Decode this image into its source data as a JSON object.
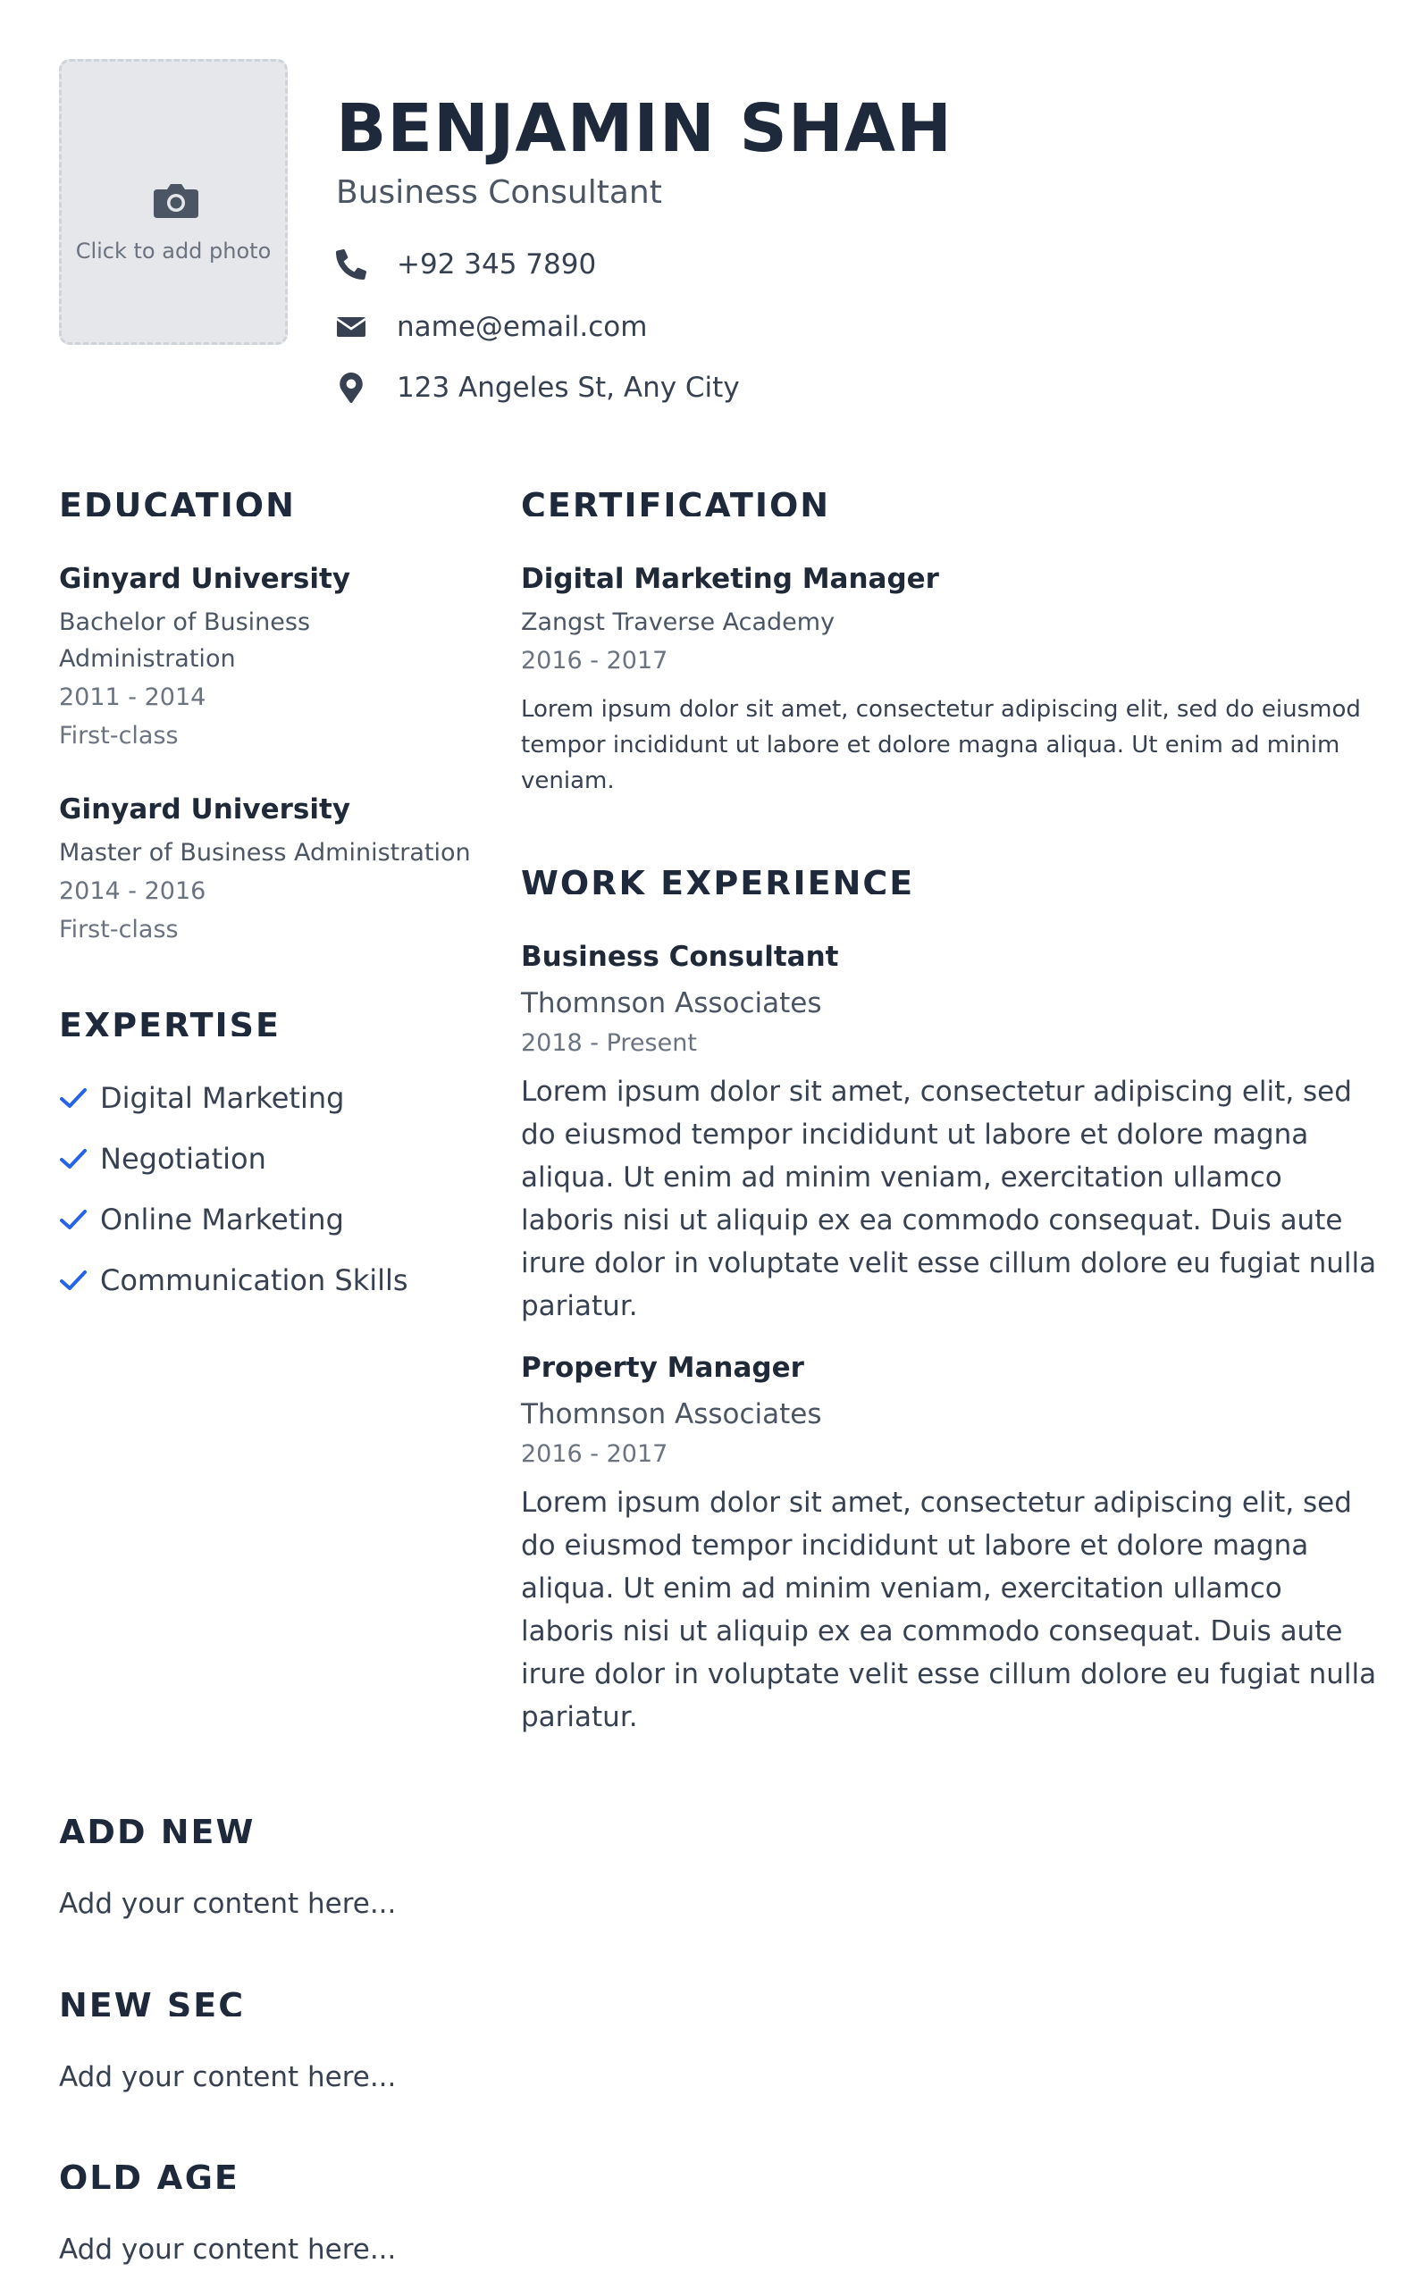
{
  "header": {
    "photo_label": "Click to add photo",
    "name": "BENJAMIN SHAH",
    "title": "Business Consultant",
    "phone": "+92 345 7890",
    "email": "name@email.com",
    "address": "123 Angeles St, Any City"
  },
  "education": {
    "title": "EDUCATION",
    "items": [
      {
        "school": "Ginyard University",
        "degree_line1": "Bachelor of Business",
        "degree_line2": "Administration",
        "years": "2011 - 2014",
        "grade": "First-class"
      },
      {
        "school": "Ginyard University",
        "degree": "Master of Business Administration",
        "years": "2014 - 2016",
        "grade": "First-class"
      }
    ]
  },
  "expertise": {
    "title": "EXPERTISE",
    "items": [
      "Digital Marketing",
      "Negotiation",
      "Online Marketing",
      "Communication Skills"
    ]
  },
  "certification": {
    "title": "CERTIFICATION",
    "name": "Digital Marketing Manager",
    "issuer": "Zangst Traverse Academy",
    "years": "2016 - 2017",
    "description": "Lorem ipsum dolor sit amet, consectetur adipiscing elit, sed do eiusmod tempor incididunt ut labore et dolore magna aliqua. Ut enim ad minim veniam."
  },
  "work": {
    "title": "WORK EXPERIENCE",
    "items": [
      {
        "role": "Business Consultant",
        "company": "Thomnson Associates",
        "years": "2018 - Present",
        "description": "Lorem ipsum dolor sit amet, consectetur adipiscing elit, sed do eiusmod tempor incididunt ut labore et dolore magna aliqua. Ut enim ad minim veniam, exercitation ullamco laboris nisi ut aliquip ex ea commodo consequat. Duis aute irure dolor in voluptate velit esse cillum dolore eu fugiat nulla pariatur."
      },
      {
        "role": "Property Manager",
        "company": "Thomnson Associates",
        "years": "2016 - 2017",
        "description": "Lorem ipsum dolor sit amet, consectetur adipiscing elit, sed do eiusmod tempor incididunt ut labore et dolore magna aliqua. Ut enim ad minim veniam, exercitation ullamco laboris nisi ut aliquip ex ea commodo consequat. Duis aute irure dolor in voluptate velit esse cillum dolore eu fugiat nulla pariatur."
      }
    ]
  },
  "custom_sections": [
    {
      "title": "ADD NEW",
      "content": "Add your content here..."
    },
    {
      "title": "NEW SEC",
      "content": "Add your content here..."
    },
    {
      "title": "OLD AGE",
      "content": "Add your content here..."
    }
  ],
  "colors": {
    "accent": "#2563eb",
    "heading": "#1e293b",
    "photo_bg": "#e5e7eb",
    "icon": "#374151"
  }
}
